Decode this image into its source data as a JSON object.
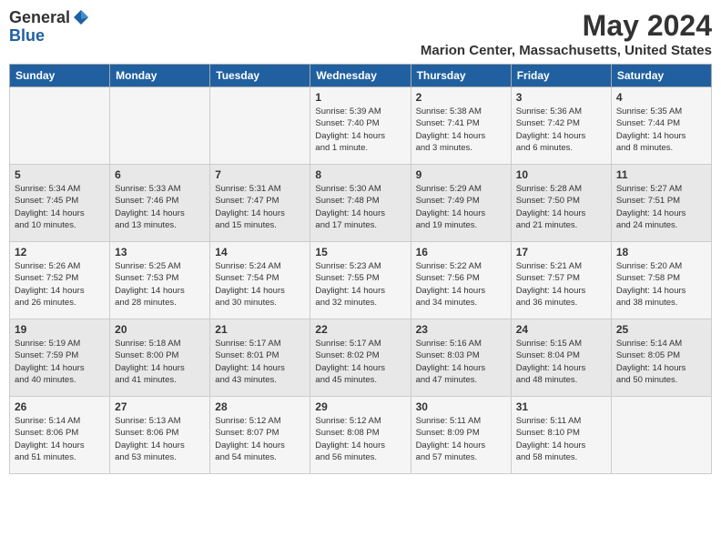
{
  "logo": {
    "general": "General",
    "blue": "Blue"
  },
  "title": "May 2024",
  "location": "Marion Center, Massachusetts, United States",
  "days_header": [
    "Sunday",
    "Monday",
    "Tuesday",
    "Wednesday",
    "Thursday",
    "Friday",
    "Saturday"
  ],
  "weeks": [
    [
      {
        "day": "",
        "content": ""
      },
      {
        "day": "",
        "content": ""
      },
      {
        "day": "",
        "content": ""
      },
      {
        "day": "1",
        "content": "Sunrise: 5:39 AM\nSunset: 7:40 PM\nDaylight: 14 hours\nand 1 minute."
      },
      {
        "day": "2",
        "content": "Sunrise: 5:38 AM\nSunset: 7:41 PM\nDaylight: 14 hours\nand 3 minutes."
      },
      {
        "day": "3",
        "content": "Sunrise: 5:36 AM\nSunset: 7:42 PM\nDaylight: 14 hours\nand 6 minutes."
      },
      {
        "day": "4",
        "content": "Sunrise: 5:35 AM\nSunset: 7:44 PM\nDaylight: 14 hours\nand 8 minutes."
      }
    ],
    [
      {
        "day": "5",
        "content": "Sunrise: 5:34 AM\nSunset: 7:45 PM\nDaylight: 14 hours\nand 10 minutes."
      },
      {
        "day": "6",
        "content": "Sunrise: 5:33 AM\nSunset: 7:46 PM\nDaylight: 14 hours\nand 13 minutes."
      },
      {
        "day": "7",
        "content": "Sunrise: 5:31 AM\nSunset: 7:47 PM\nDaylight: 14 hours\nand 15 minutes."
      },
      {
        "day": "8",
        "content": "Sunrise: 5:30 AM\nSunset: 7:48 PM\nDaylight: 14 hours\nand 17 minutes."
      },
      {
        "day": "9",
        "content": "Sunrise: 5:29 AM\nSunset: 7:49 PM\nDaylight: 14 hours\nand 19 minutes."
      },
      {
        "day": "10",
        "content": "Sunrise: 5:28 AM\nSunset: 7:50 PM\nDaylight: 14 hours\nand 21 minutes."
      },
      {
        "day": "11",
        "content": "Sunrise: 5:27 AM\nSunset: 7:51 PM\nDaylight: 14 hours\nand 24 minutes."
      }
    ],
    [
      {
        "day": "12",
        "content": "Sunrise: 5:26 AM\nSunset: 7:52 PM\nDaylight: 14 hours\nand 26 minutes."
      },
      {
        "day": "13",
        "content": "Sunrise: 5:25 AM\nSunset: 7:53 PM\nDaylight: 14 hours\nand 28 minutes."
      },
      {
        "day": "14",
        "content": "Sunrise: 5:24 AM\nSunset: 7:54 PM\nDaylight: 14 hours\nand 30 minutes."
      },
      {
        "day": "15",
        "content": "Sunrise: 5:23 AM\nSunset: 7:55 PM\nDaylight: 14 hours\nand 32 minutes."
      },
      {
        "day": "16",
        "content": "Sunrise: 5:22 AM\nSunset: 7:56 PM\nDaylight: 14 hours\nand 34 minutes."
      },
      {
        "day": "17",
        "content": "Sunrise: 5:21 AM\nSunset: 7:57 PM\nDaylight: 14 hours\nand 36 minutes."
      },
      {
        "day": "18",
        "content": "Sunrise: 5:20 AM\nSunset: 7:58 PM\nDaylight: 14 hours\nand 38 minutes."
      }
    ],
    [
      {
        "day": "19",
        "content": "Sunrise: 5:19 AM\nSunset: 7:59 PM\nDaylight: 14 hours\nand 40 minutes."
      },
      {
        "day": "20",
        "content": "Sunrise: 5:18 AM\nSunset: 8:00 PM\nDaylight: 14 hours\nand 41 minutes."
      },
      {
        "day": "21",
        "content": "Sunrise: 5:17 AM\nSunset: 8:01 PM\nDaylight: 14 hours\nand 43 minutes."
      },
      {
        "day": "22",
        "content": "Sunrise: 5:17 AM\nSunset: 8:02 PM\nDaylight: 14 hours\nand 45 minutes."
      },
      {
        "day": "23",
        "content": "Sunrise: 5:16 AM\nSunset: 8:03 PM\nDaylight: 14 hours\nand 47 minutes."
      },
      {
        "day": "24",
        "content": "Sunrise: 5:15 AM\nSunset: 8:04 PM\nDaylight: 14 hours\nand 48 minutes."
      },
      {
        "day": "25",
        "content": "Sunrise: 5:14 AM\nSunset: 8:05 PM\nDaylight: 14 hours\nand 50 minutes."
      }
    ],
    [
      {
        "day": "26",
        "content": "Sunrise: 5:14 AM\nSunset: 8:06 PM\nDaylight: 14 hours\nand 51 minutes."
      },
      {
        "day": "27",
        "content": "Sunrise: 5:13 AM\nSunset: 8:06 PM\nDaylight: 14 hours\nand 53 minutes."
      },
      {
        "day": "28",
        "content": "Sunrise: 5:12 AM\nSunset: 8:07 PM\nDaylight: 14 hours\nand 54 minutes."
      },
      {
        "day": "29",
        "content": "Sunrise: 5:12 AM\nSunset: 8:08 PM\nDaylight: 14 hours\nand 56 minutes."
      },
      {
        "day": "30",
        "content": "Sunrise: 5:11 AM\nSunset: 8:09 PM\nDaylight: 14 hours\nand 57 minutes."
      },
      {
        "day": "31",
        "content": "Sunrise: 5:11 AM\nSunset: 8:10 PM\nDaylight: 14 hours\nand 58 minutes."
      },
      {
        "day": "",
        "content": ""
      }
    ]
  ]
}
